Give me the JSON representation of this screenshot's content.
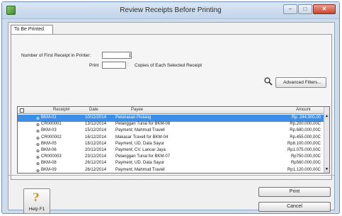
{
  "window": {
    "title": "Review Receipts Before Printing"
  },
  "tabs": [
    {
      "label": "To Be Printed"
    }
  ],
  "form": {
    "num_first_receipt_label": "Number of First Receipt in Printer:",
    "num_first_receipt_value": "",
    "print_label": "Print",
    "print_value": "",
    "copies_label": "Copies of Each Selected Receipt"
  },
  "advanced_filters_label": "Advanced Filters...",
  "grid": {
    "columns": [
      "Receipt#",
      "Date",
      "Payee",
      "Amount"
    ],
    "rows": [
      {
        "icon": "⊕",
        "receipt": "BKM-01",
        "date": "10/12/2014",
        "payee": "Pelunasan Piutang",
        "amount": "Rp. 244.900,00",
        "selected": true
      },
      {
        "icon": "⊕",
        "receipt": "CR000001",
        "date": "13/12/2014",
        "payee": "Pelanggan Tunai for BKM-08",
        "amount": "Rp.200.000,00C",
        "selected": false
      },
      {
        "icon": "⊕",
        "receipt": "BKM-03",
        "date": "15/12/2014",
        "payee": "Payment; Mahmud Travell",
        "amount": "Rp.680.000,00C",
        "selected": false
      },
      {
        "icon": "⊕",
        "receipt": "CR000002",
        "date": "16/12/2014",
        "payee": "Makasar Travell for BKM-04",
        "amount": "Rp.455.000,00C",
        "selected": false
      },
      {
        "icon": "⊕",
        "receipt": "BKM-05",
        "date": "18/12/2014",
        "payee": "Payment; UD. Data Sayur",
        "amount": "Rp8.100.000,00C",
        "selected": false
      },
      {
        "icon": "⊕",
        "receipt": "BKM-06",
        "date": "20/12/2014",
        "payee": "Payment; CV. Lancar Jaya",
        "amount": "Rp1.075.000,00C",
        "selected": false
      },
      {
        "icon": "⊕",
        "receipt": "CR000003",
        "date": "23/12/2014",
        "payee": "Pelanggan Tunai for BKM-07",
        "amount": "Rp750.000,00C",
        "selected": false
      },
      {
        "icon": "⊕",
        "receipt": "BKM-08",
        "date": "26/12/2014",
        "payee": "Payment; UD. Data Sayur",
        "amount": "Rp560.000,00C",
        "selected": false
      },
      {
        "icon": "⊕",
        "receipt": "BKM-09",
        "date": "26/12/2014",
        "payee": "Payment; Mahmud Travell",
        "amount": "Rp1.120.000,00C",
        "selected": false
      }
    ]
  },
  "buttons": {
    "help": "Help F1",
    "print": "Print",
    "cancel": "Cancel"
  },
  "colors": {
    "selection": "#3c8ee6",
    "window_frame": "#cfdcea"
  }
}
